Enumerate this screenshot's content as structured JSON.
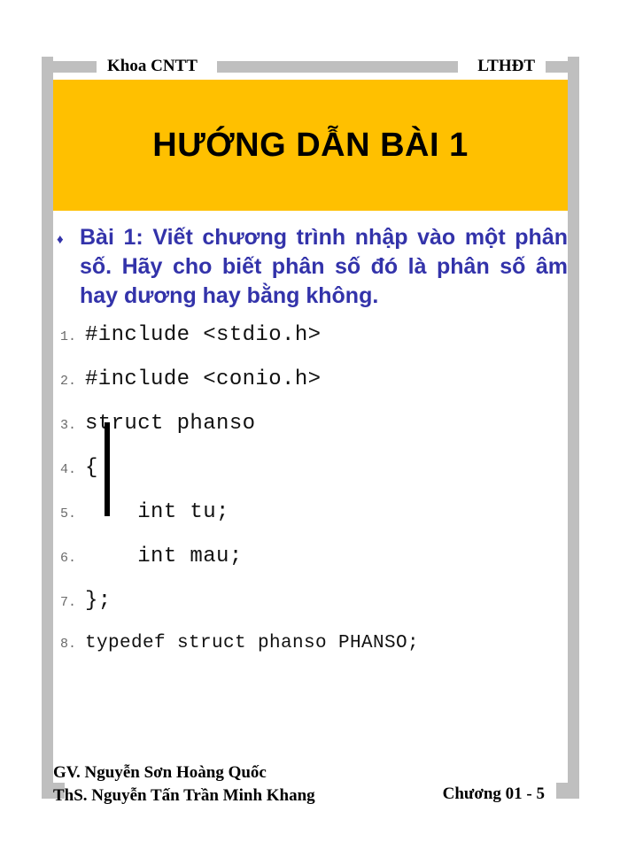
{
  "header": {
    "left_label": "Khoa CNTT",
    "right_label": "LTHĐT"
  },
  "title": {
    "text": "HƯỚNG DẪN BÀI 1",
    "background_color": "#FFC000",
    "text_color": "#000000"
  },
  "bullet": {
    "marker": "♦",
    "marker_color": "#3333AA",
    "text": "Bài 1: Viết chương trình nhập vào một phân số. Hãy cho biết phân số đó là phân số âm hay dương hay bằng không.",
    "text_color": "#3333AA"
  },
  "code": {
    "lines": [
      {
        "num": "1.",
        "text": "#include <stdio.h>"
      },
      {
        "num": "2.",
        "text": "#include <conio.h>"
      },
      {
        "num": "3.",
        "text": "struct phanso"
      },
      {
        "num": "4.",
        "text": "{"
      },
      {
        "num": "5.",
        "text": "    int tu;"
      },
      {
        "num": "6.",
        "text": "    int mau;"
      },
      {
        "num": "7.",
        "text": "};"
      },
      {
        "num": "8.",
        "text": "typedef struct phanso PHANSO;"
      }
    ],
    "number_color": "#6B6B6B",
    "text_color": "#111111"
  },
  "footer": {
    "author_line1": "GV. Nguyễn Sơn Hoàng Quốc",
    "author_line2": "ThS. Nguyễn Tấn Trần Minh Khang",
    "page_label": "Chương 01 - 5"
  },
  "theme": {
    "rail_gray": "#BFBFBF",
    "accent": "#FFC000",
    "bullet_blue": "#3333AA"
  }
}
